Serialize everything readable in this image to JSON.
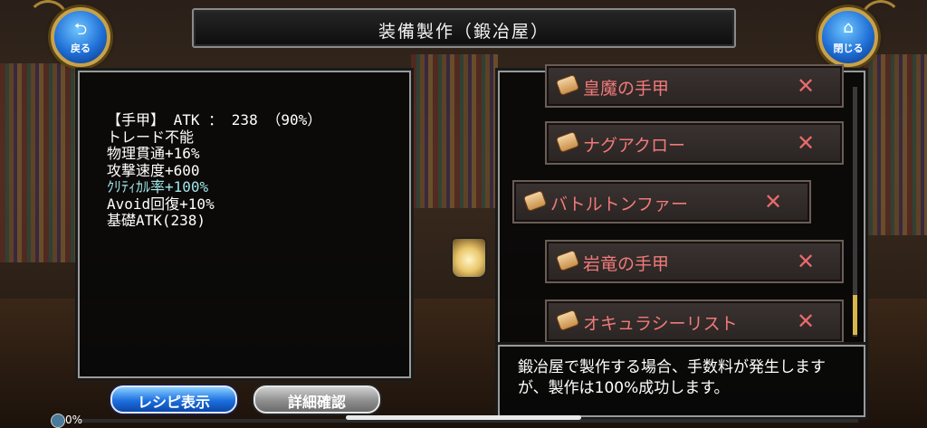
{
  "header": {
    "title": "装備製作（鍛冶屋）",
    "back_button": {
      "label": "戻る",
      "icon": "back-arrow-icon"
    },
    "close_button": {
      "label": "閉じる",
      "icon": "home-icon"
    }
  },
  "info_panel": {
    "lines": [
      "【手甲】 ATK ： 238 （90%）",
      "トレード不能",
      "物理貫通+16%",
      "攻撃速度+600",
      "ｸﾘﾃｨｶﾙ率+100%",
      "Avoid回復+10%",
      "基礎ATK(238)"
    ],
    "highlight_color": "#9fe6ea"
  },
  "recipes": [
    {
      "name": "皇魔の手甲",
      "remove": "✕"
    },
    {
      "name": "ナグアクロー",
      "remove": "✕"
    },
    {
      "name": "バトルトンファー",
      "remove": "✕",
      "selected": true
    },
    {
      "name": "岩竜の手甲",
      "remove": "✕"
    },
    {
      "name": "オキュラシーリスト",
      "remove": "✕"
    }
  ],
  "description": "鍛冶屋で製作する場合、手数料が発生しますが、製作は100%成功します。",
  "buttons": {
    "recipe_display": "レシピ表示",
    "detail_confirm": "詳細確認"
  },
  "progress": {
    "label": "0%",
    "value": 0
  },
  "colors": {
    "recipe_text": "#f07a7a",
    "accent_gold": "#c8a24a",
    "button_blue": "#1c6fe0"
  }
}
